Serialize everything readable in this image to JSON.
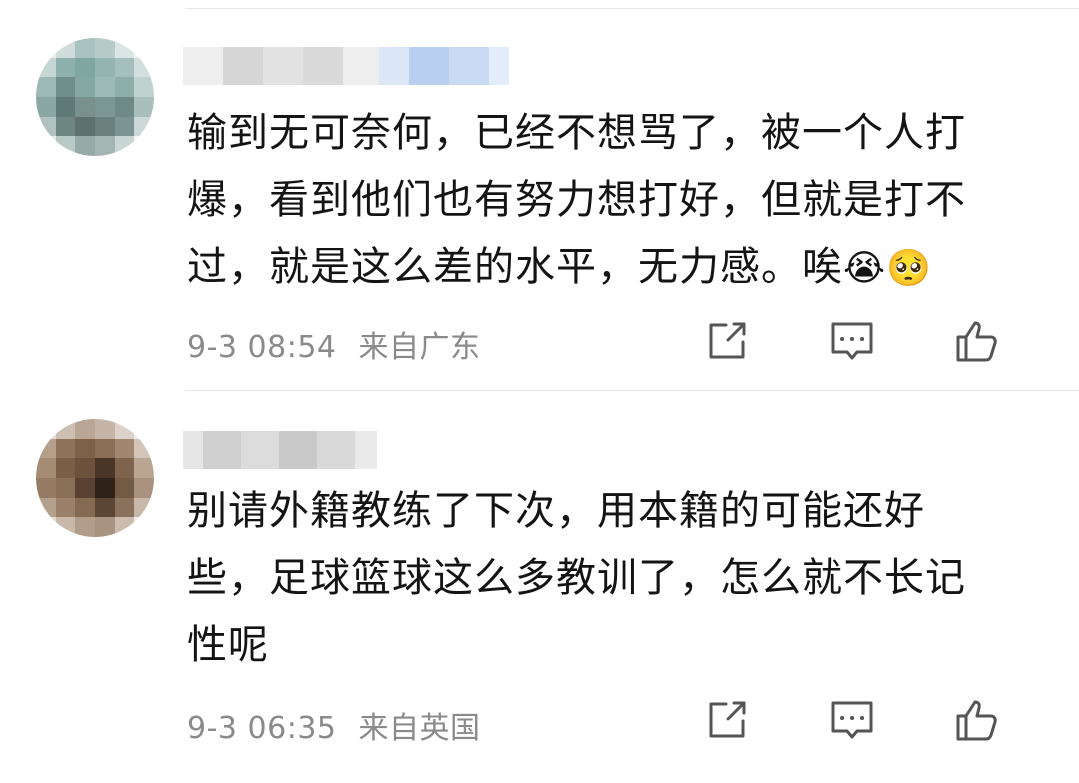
{
  "comments": [
    {
      "text_line1": "输到无可奈何，已经不想骂了，被一个人打",
      "text_line2": "爆，看到他们也有努力想打好，但就是打不",
      "text_line3": "过，就是这么差的水平，无力感。唉",
      "emojis": "😭🥺",
      "time": "9-3 08:54",
      "location": "来自广东"
    },
    {
      "text_line1": "别请外籍教练了下次，用本籍的可能还好",
      "text_line2": "些，足球篮球这么多教训了，怎么就不长记",
      "text_line3": "性呢",
      "time": "9-3 06:35",
      "location": "来自英国"
    }
  ],
  "icons": [
    "share-icon",
    "comment-icon",
    "like-icon"
  ],
  "colors": {
    "text": "#141414",
    "meta": "#8a8a8a",
    "divider": "#e8e8e8"
  }
}
